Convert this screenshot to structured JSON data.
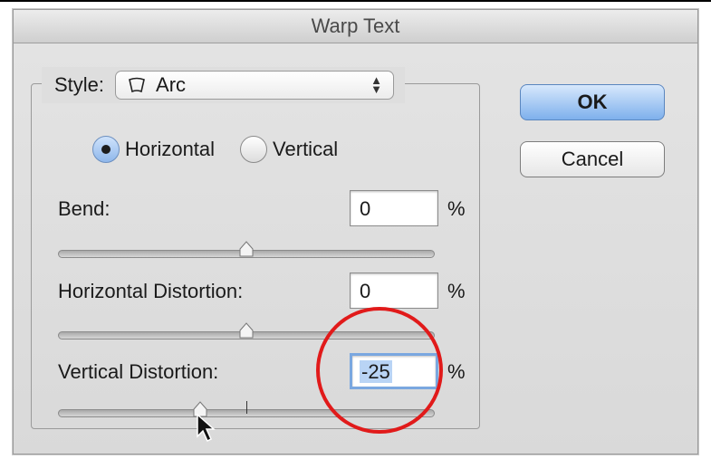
{
  "dialog": {
    "title": "Warp Text"
  },
  "style": {
    "label": "Style:",
    "value": "Arc",
    "icon": "arc-warp-icon"
  },
  "orientation": {
    "options": [
      {
        "label": "Horizontal",
        "checked": true
      },
      {
        "label": "Vertical",
        "checked": false
      }
    ]
  },
  "bend": {
    "label": "Bend:",
    "value": "0",
    "unit": "%",
    "slider_value": 0
  },
  "horizontal_distortion": {
    "label": "Horizontal Distortion:",
    "value": "0",
    "unit": "%",
    "slider_value": 0
  },
  "vertical_distortion": {
    "label": "Vertical Distortion:",
    "value": "-25",
    "unit": "%",
    "slider_value": -25
  },
  "buttons": {
    "ok": "OK",
    "cancel": "Cancel"
  },
  "colors": {
    "annotation_circle": "#e11a1a",
    "default_button": "#7eb0ec",
    "selection": "#b9d4f5"
  }
}
